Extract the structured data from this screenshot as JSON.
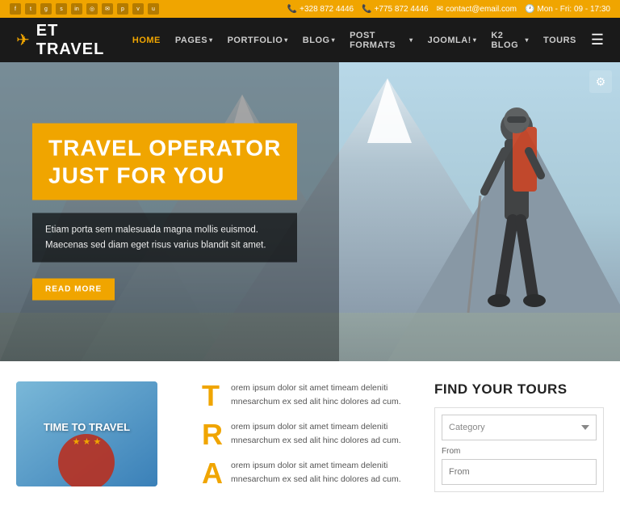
{
  "topbar": {
    "social_icons": [
      "f",
      "t",
      "g+",
      "in",
      "yt",
      "rss",
      "mail",
      "pin",
      "vine",
      "u"
    ],
    "phone1": "+328 872 4446",
    "phone2": "+775 872 4446",
    "email": "contact@email.com",
    "hours": "Mon - Fri:  09 - 17:30"
  },
  "header": {
    "logo_text": "ET TRAVEL",
    "nav_items": [
      {
        "label": "HOME",
        "has_arrow": false,
        "active": true
      },
      {
        "label": "PAGES",
        "has_arrow": true
      },
      {
        "label": "PORTFOLIO",
        "has_arrow": true
      },
      {
        "label": "BLOG",
        "has_arrow": true
      },
      {
        "label": "POST FORMATS",
        "has_arrow": true
      },
      {
        "label": "JOOMLA!",
        "has_arrow": true
      },
      {
        "label": "K2 BLOG",
        "has_arrow": true
      },
      {
        "label": "TOURS",
        "has_arrow": false
      }
    ]
  },
  "hero": {
    "title_line1": "TRAVEL OPERATOR",
    "title_line2": "JUST FOR YOU",
    "description": "Etiam porta sem malesuada magna mollis euismod.\nMaecenas sed diam eget risus varius blandit sit amet.",
    "read_more": "READ MORE"
  },
  "bottom": {
    "card": {
      "text": "TIME TO TRAVEL",
      "stars": "★ ★ ★"
    },
    "content": [
      {
        "drop_cap": "T",
        "text": "orem ipsum dolor sit amet timeam deleniti mnesarchum ex sed alit hinc dolores ad cum."
      },
      {
        "drop_cap": "R",
        "text": "orem ipsum dolor sit amet timeam deleniti mnesarchum ex sed alit hinc dolores ad cum."
      },
      {
        "drop_cap": "A",
        "text": "orem ipsum dolor sit amet timeam deleniti mnesarchum ex sed alit hinc dolores ad cum."
      }
    ],
    "find_tours": {
      "title": "FIND YOUR TOURS",
      "category_placeholder": "Category",
      "from_label": "From"
    }
  },
  "colors": {
    "accent": "#f0a500",
    "dark": "#1a1a1a",
    "text": "#555"
  }
}
